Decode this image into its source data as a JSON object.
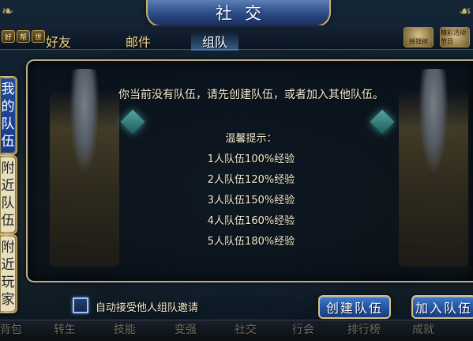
{
  "window": {
    "title": "社交"
  },
  "tabs": [
    {
      "label": "好友",
      "active": false
    },
    {
      "label": "邮件",
      "active": false
    },
    {
      "label": "组队",
      "active": true
    }
  ],
  "top_left_icons": [
    "好",
    "帮",
    "世"
  ],
  "top_right_icons": [
    "摇钱树",
    "精彩活动节日"
  ],
  "side_tabs": [
    {
      "chars": [
        "我",
        "的",
        "队",
        "伍"
      ],
      "active": true
    },
    {
      "chars": [
        "附",
        "近",
        "队",
        "伍"
      ],
      "active": false
    },
    {
      "chars": [
        "附",
        "近",
        "玩",
        "家"
      ],
      "active": false
    }
  ],
  "panel": {
    "message": "你当前没有队伍，请先创建队伍，或者加入其他队伍。",
    "tips_title": "温馨提示：",
    "tips": [
      "1人队伍100%经验",
      "2人队伍120%经验",
      "3人队伍150%经验",
      "4人队伍160%经验",
      "5人队伍180%经验"
    ]
  },
  "auto_accept": {
    "label": "自动接受他人组队邀请",
    "checked": false
  },
  "buttons": {
    "create_team": "创建队伍",
    "join_team": "加入队伍"
  },
  "bottom_nav": [
    "背包",
    "转生",
    "技能",
    "变强",
    "社交",
    "行会",
    "排行榜",
    "成就"
  ],
  "colors": {
    "accent_blue": "#2557a6",
    "gold_border": "#d4c189",
    "tab_text": "#f0d98a"
  }
}
